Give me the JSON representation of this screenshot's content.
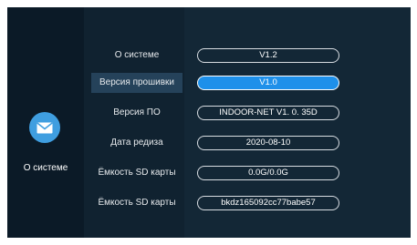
{
  "nav": {
    "icon": "envelope-icon",
    "label": "О системе"
  },
  "info_rows": [
    {
      "label": "О системе",
      "value": "V1.2",
      "active": false
    },
    {
      "label": "Версия  прошивки",
      "value": "V1.0",
      "active": true
    },
    {
      "label": "Версия ПО",
      "value": "INDOOR-NET  V1. 0. 35D",
      "active": false
    },
    {
      "label": "Дата редиза",
      "value": "2020-08-10",
      "active": false
    },
    {
      "label": "Ёмкость SD карты",
      "value": "0.0G/0.0G",
      "active": false
    },
    {
      "label": "Ёмкость SD карты",
      "value": "bkdz165092cc77babe57",
      "active": false
    }
  ],
  "colors": {
    "background": "#0b1a27",
    "panel": "#132736",
    "highlight": "#25425a",
    "accent": "#1e90ea"
  }
}
